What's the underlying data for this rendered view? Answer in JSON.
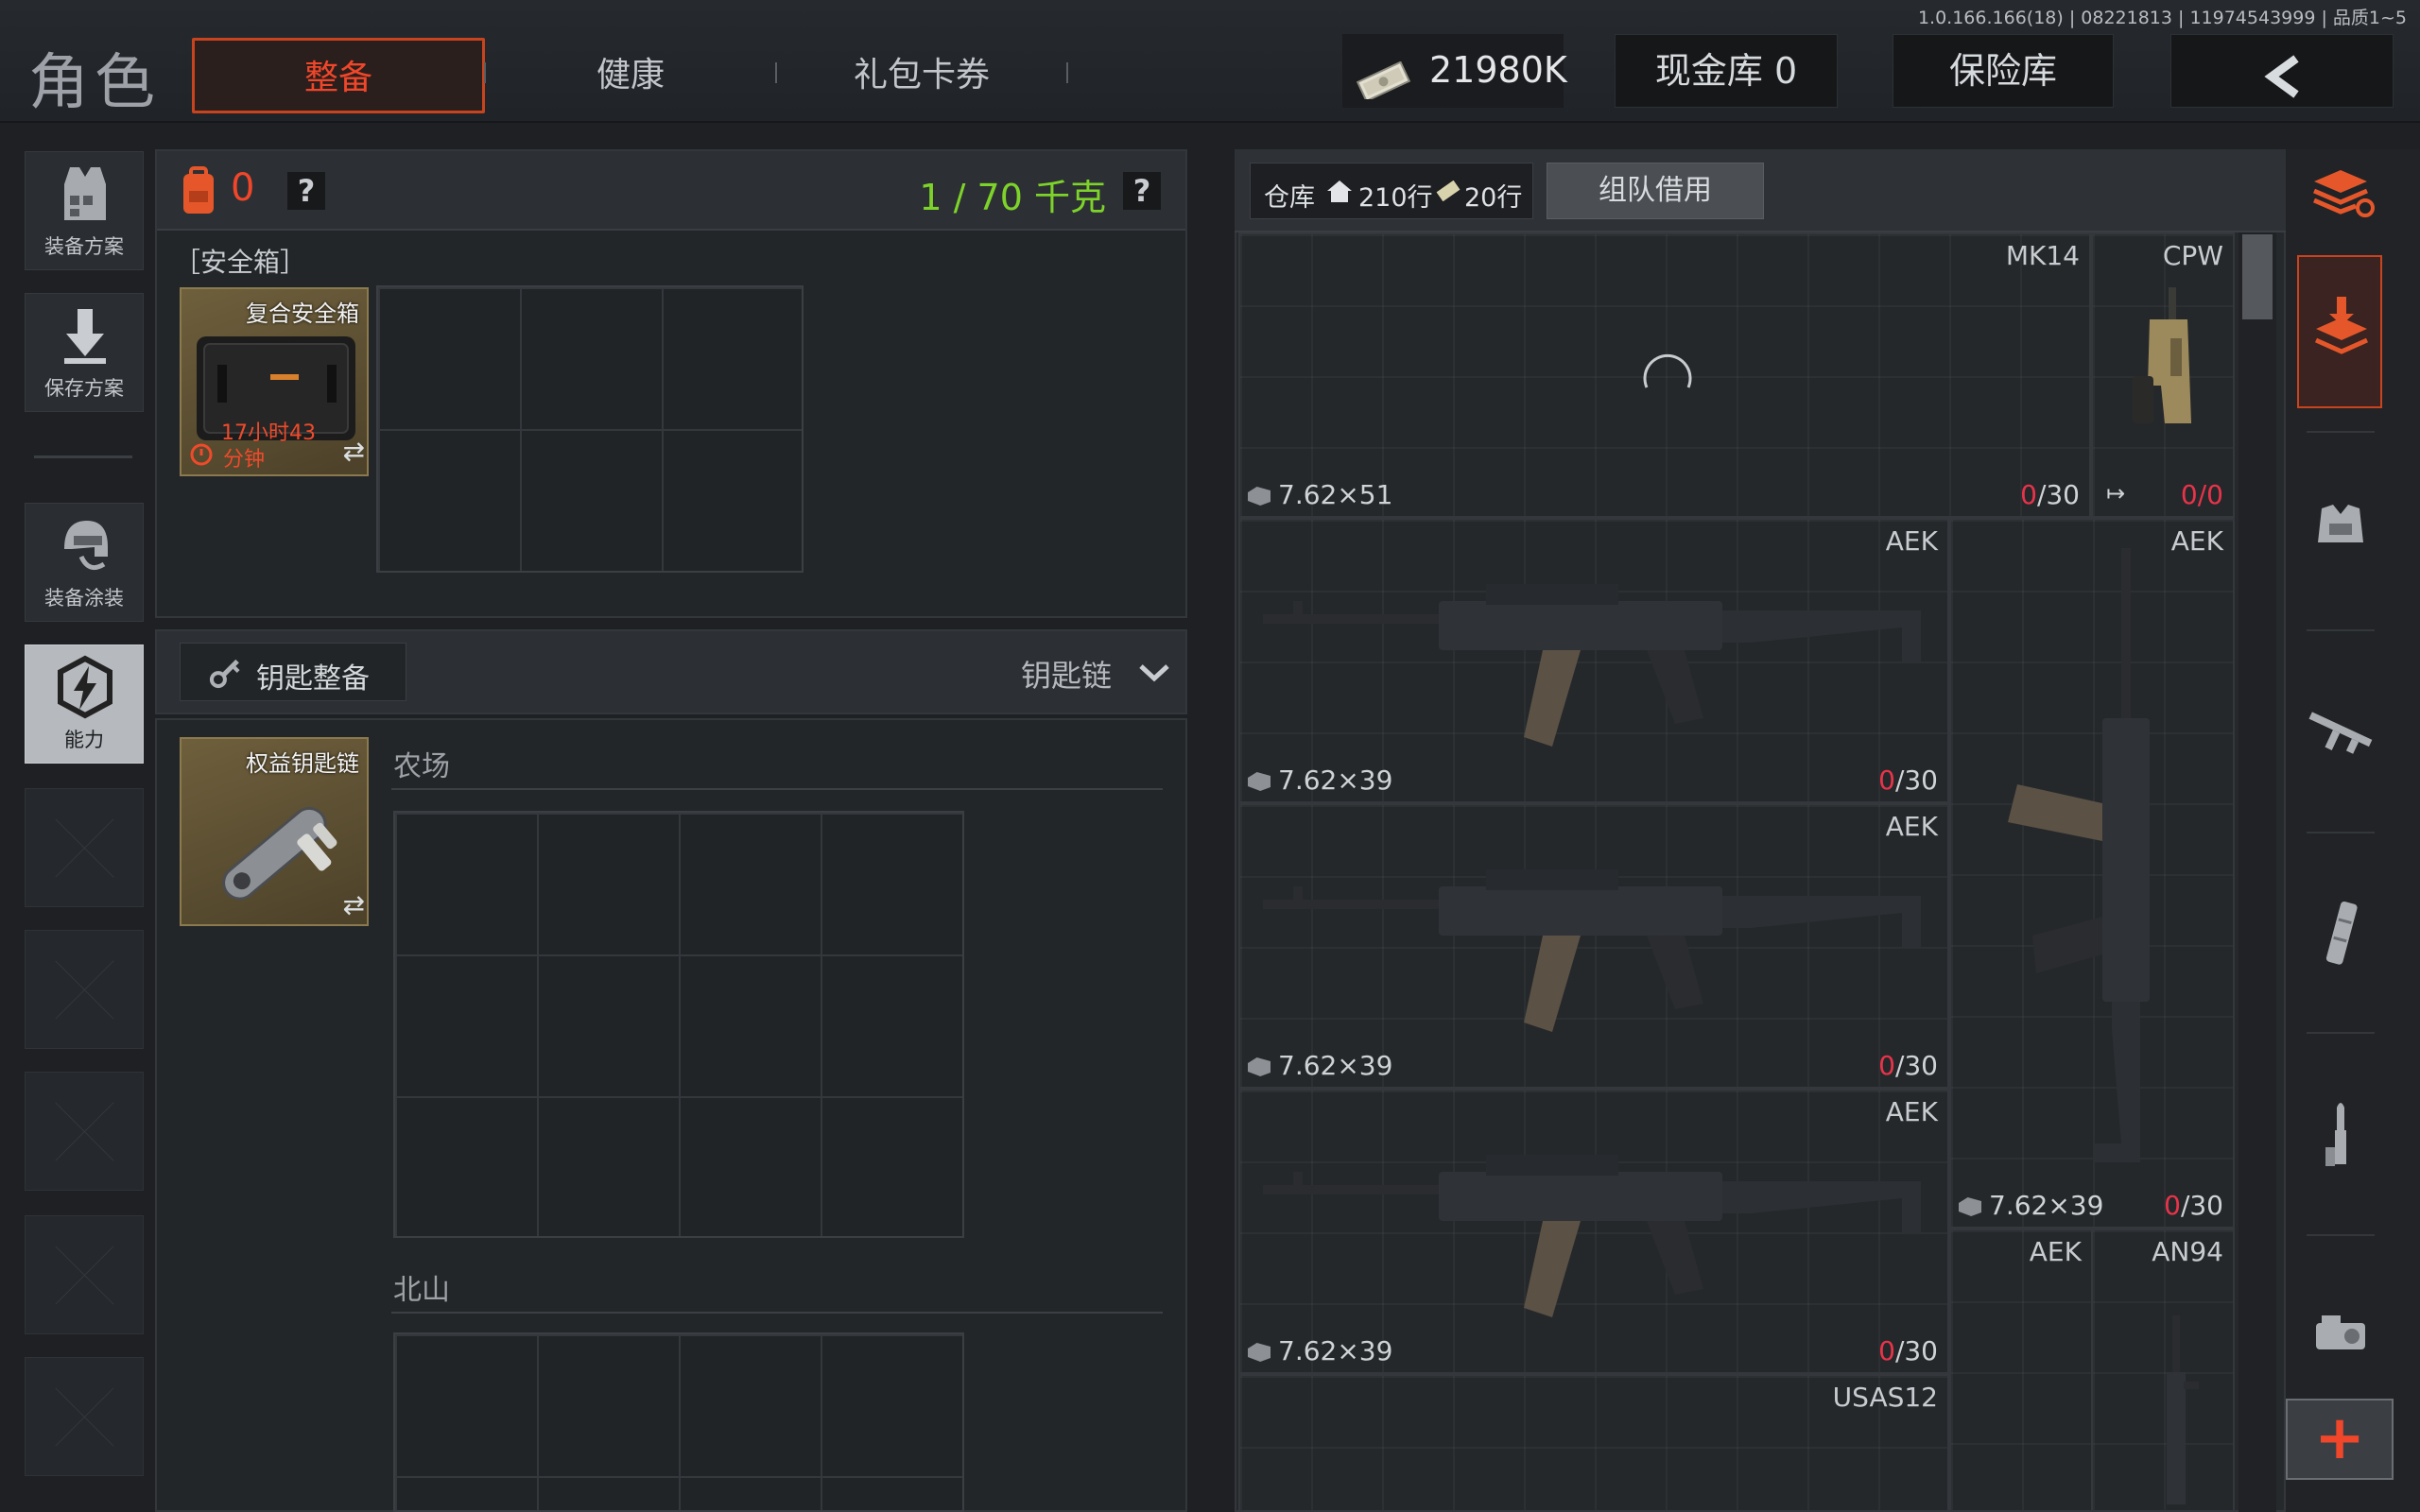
{
  "version_info": "1.0.166.166(18) | 08221813 | 11974543999 | 品质1~5",
  "app_title": "角色",
  "tabs": [
    {
      "label": "整备",
      "active": true
    },
    {
      "label": "健康",
      "active": false
    },
    {
      "label": "礼包卡券",
      "active": false
    }
  ],
  "header": {
    "currency_value": "21980K",
    "cash_vault_label": "现金库 0",
    "safe_vault_label": "保险库",
    "back_icon": "chevron-left-icon"
  },
  "sidebar": {
    "items": [
      {
        "label": "装备方案",
        "icon": "vest-icon"
      },
      {
        "label": "保存方案",
        "icon": "download-icon"
      },
      {
        "label": "装备涂装",
        "icon": "helmet-paint-icon"
      },
      {
        "label": "能力",
        "icon": "lightning-hex-icon"
      }
    ]
  },
  "loadout": {
    "backpack_count": "0",
    "help_label": "?",
    "weight_label": "1 / 70 千克",
    "safebox_title": "［安全箱］",
    "safebox_item": {
      "name": "复合安全箱",
      "timer_line1": "17小时43",
      "timer_line2": "分钟"
    }
  },
  "keys": {
    "section_label": "钥匙整备",
    "dropdown_label": "钥匙链",
    "key_item_name": "权益钥匙链",
    "areas": [
      "农场",
      "北山"
    ]
  },
  "warehouse": {
    "tab_label": "仓库",
    "rows_label": "210行",
    "ticket_rows_label": "20行",
    "team_borrow_label": "组队借用",
    "items": [
      {
        "name": "MK14",
        "caliber": "7.62×51",
        "mag_current": "0",
        "mag_max": "/30"
      },
      {
        "name": "CPW",
        "caliber": "",
        "mag_current": "0",
        "mag_max": "/0"
      },
      {
        "name": "AEK",
        "caliber": "7.62×39",
        "mag_current": "0",
        "mag_max": "/30"
      },
      {
        "name": "AEK",
        "caliber": "7.62×39",
        "mag_current": "0",
        "mag_max": "/30"
      },
      {
        "name": "AEK",
        "caliber": "7.62×39",
        "mag_current": "0",
        "mag_max": "/30"
      },
      {
        "name": "AEK",
        "caliber": "7.62×39",
        "mag_current": "0",
        "mag_max": "/30"
      },
      {
        "name": "AEK",
        "caliber": "",
        "mag_current": "",
        "mag_max": ""
      },
      {
        "name": "AN94",
        "caliber": "",
        "mag_current": "",
        "mag_max": ""
      },
      {
        "name": "USAS12",
        "caliber": "",
        "mag_current": "",
        "mag_max": ""
      }
    ]
  },
  "toolbar_right": {
    "tools": [
      "layers-refresh-icon",
      "layers-download-icon",
      "armor-icon",
      "rifle-icon",
      "magazine-icon",
      "bullet-icon",
      "scope-icon"
    ],
    "add_label": "+"
  },
  "colors": {
    "accent": "#f0462a",
    "weight_green": "#7ed32a",
    "mag_red": "#e8334a"
  }
}
